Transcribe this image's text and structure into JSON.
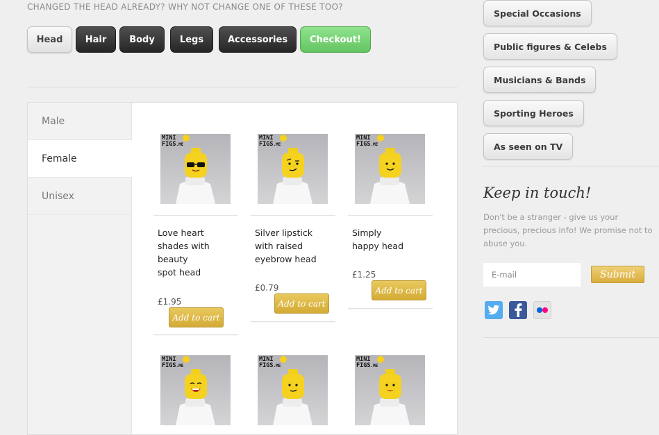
{
  "header": {
    "tagline": "CHANGED THE HEAD ALREADY?  WHY NOT CHANGE ONE OF THESE TOO?",
    "buttons": [
      {
        "label": "Head",
        "style": "light"
      },
      {
        "label": "Hair",
        "style": "dark"
      },
      {
        "label": "Body",
        "style": "dark"
      },
      {
        "label": "Legs",
        "style": "dark"
      },
      {
        "label": "Accessories",
        "style": "dark"
      },
      {
        "label": "Checkout!",
        "style": "green"
      }
    ]
  },
  "tabs": [
    {
      "label": "Male"
    },
    {
      "label": "Female",
      "active": true
    },
    {
      "label": "Unisex"
    }
  ],
  "logo": {
    "line1": "MINI",
    "line2": "FIGS",
    "suffix": ".ME"
  },
  "products": [
    {
      "name": "Love heart\nshades with\nbeauty\nspot head",
      "price": "£1.95",
      "cart_label": "Add to cart",
      "face": "shades"
    },
    {
      "name": "Silver lipstick\nwith raised\neyebrow head",
      "price": "£0.79",
      "cart_label": "Add to cart",
      "face": "eyebrow"
    },
    {
      "name": "Simply\nhappy head",
      "price": "£1.25",
      "cart_label": "Add to cart",
      "face": "happy"
    },
    {
      "name": "",
      "price": "",
      "cart_label": "",
      "face": "grin"
    },
    {
      "name": "",
      "price": "",
      "cart_label": "",
      "face": "smirk"
    },
    {
      "name": "",
      "price": "",
      "cart_label": "",
      "face": "lips"
    }
  ],
  "categories": [
    {
      "label": "Special Occasions"
    },
    {
      "label": "Public figures & Celebs"
    },
    {
      "label": "Musicians & Bands"
    },
    {
      "label": "Sporting Heroes"
    },
    {
      "label": "As seen on TV"
    }
  ],
  "newsletter": {
    "title": "Keep in touch!",
    "description": "Don't be a stranger - give us your precious, precious info! We promise not to abuse you.",
    "email_placeholder": "E-mail",
    "submit_label": "Submit"
  },
  "social": [
    {
      "icon": "twitter-icon",
      "color": "#55acee"
    },
    {
      "icon": "facebook-icon",
      "color": "#3b5998"
    },
    {
      "icon": "flickr-icon",
      "color": "#ff0084"
    }
  ],
  "colors": {
    "accent_gold": "#d8ad3c",
    "checkout_green": "#64c462"
  }
}
